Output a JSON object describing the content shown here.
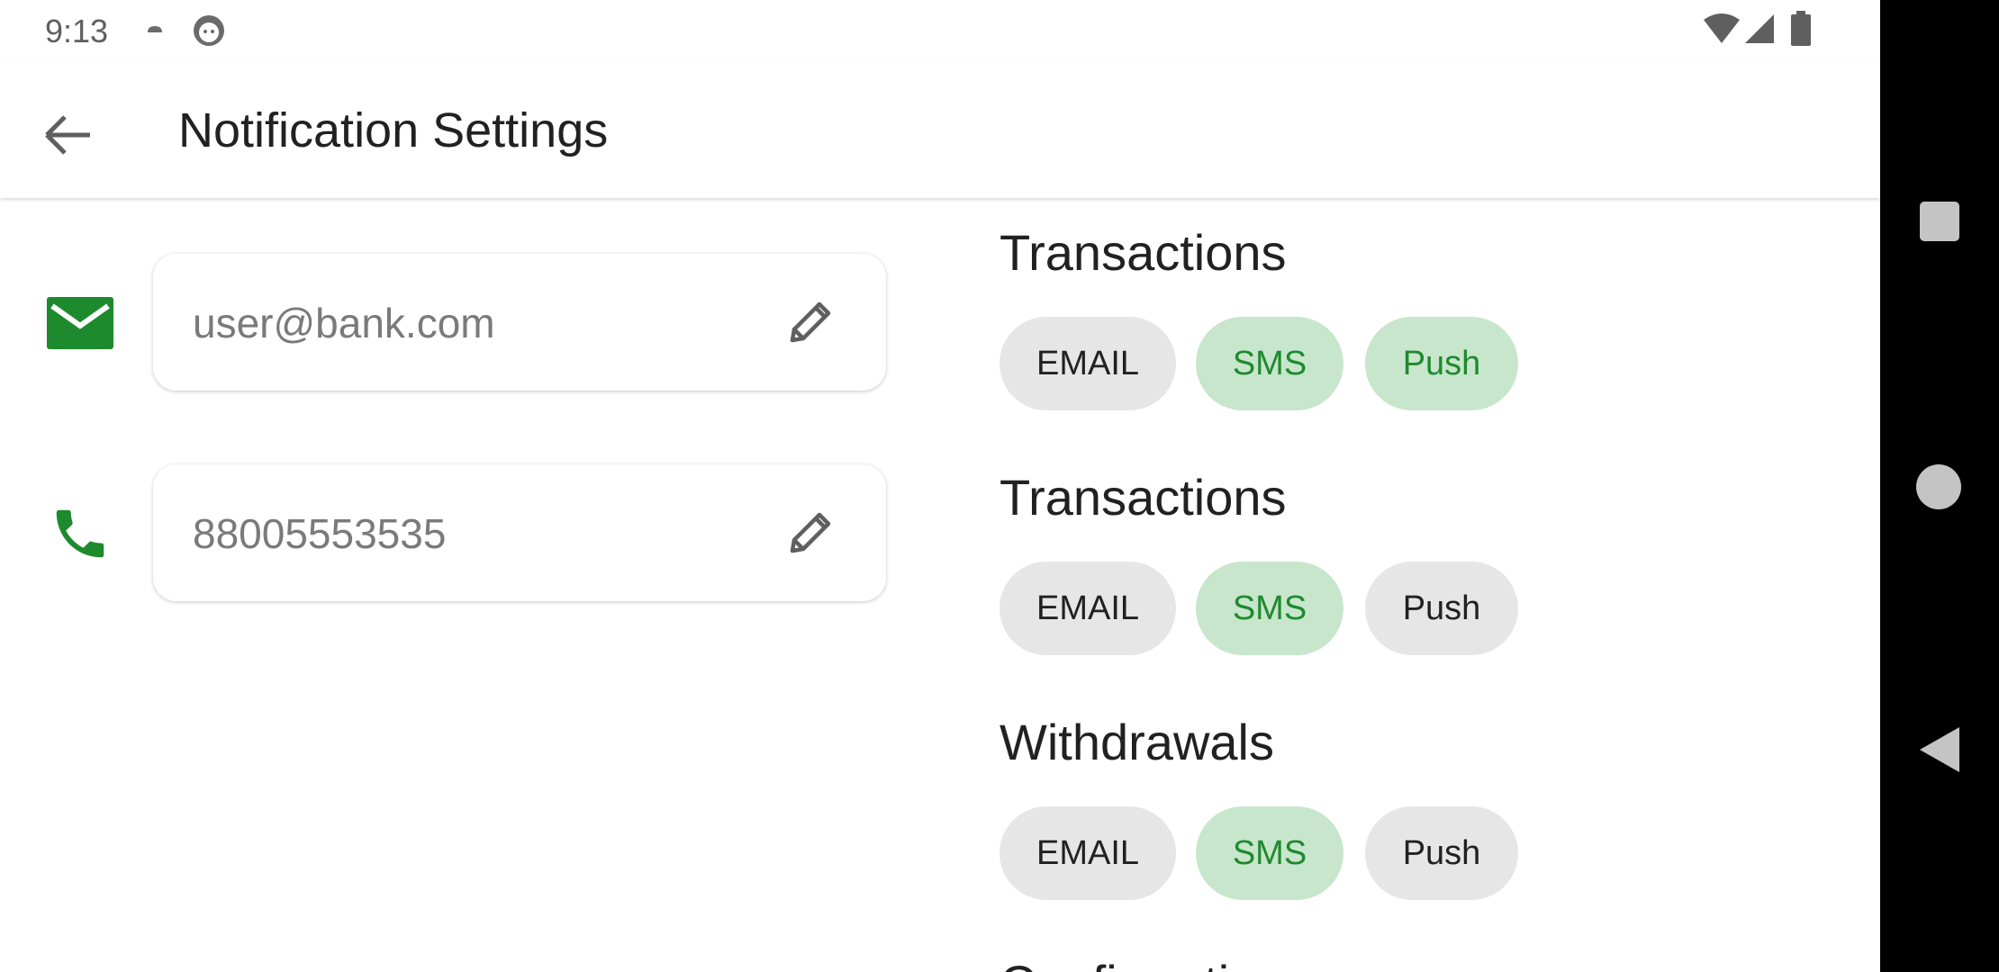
{
  "status_bar": {
    "time": "9:13",
    "icons": [
      "weather-icon",
      "android-debug-icon",
      "wifi-icon",
      "signal-icon",
      "battery-icon"
    ]
  },
  "app_bar": {
    "title": "Notification Settings",
    "back_icon": "arrow-back-icon"
  },
  "contacts": {
    "email": {
      "value": "user@bank.com",
      "icon": "mail-icon",
      "edit_icon": "pencil-icon"
    },
    "phone": {
      "value": "88005553535",
      "icon": "phone-icon",
      "edit_icon": "pencil-icon"
    }
  },
  "sections": [
    {
      "title": "Transactions",
      "chips": [
        {
          "label": "EMAIL",
          "selected": false
        },
        {
          "label": "SMS",
          "selected": true
        },
        {
          "label": "Push",
          "selected": true
        }
      ]
    },
    {
      "title": "Transactions",
      "chips": [
        {
          "label": "EMAIL",
          "selected": false
        },
        {
          "label": "SMS",
          "selected": true
        },
        {
          "label": "Push",
          "selected": false
        }
      ]
    },
    {
      "title": "Withdrawals",
      "chips": [
        {
          "label": "EMAIL",
          "selected": false
        },
        {
          "label": "SMS",
          "selected": true
        },
        {
          "label": "Push",
          "selected": false
        }
      ]
    },
    {
      "title": "Confirmations"
    }
  ],
  "colors": {
    "accent_green": "#1e8a2e",
    "chip_selected_bg": "#c8e6cc",
    "chip_bg": "#e6e6e6"
  },
  "nav_bar": {
    "icons": [
      "recents-icon",
      "home-icon",
      "back-icon"
    ]
  }
}
